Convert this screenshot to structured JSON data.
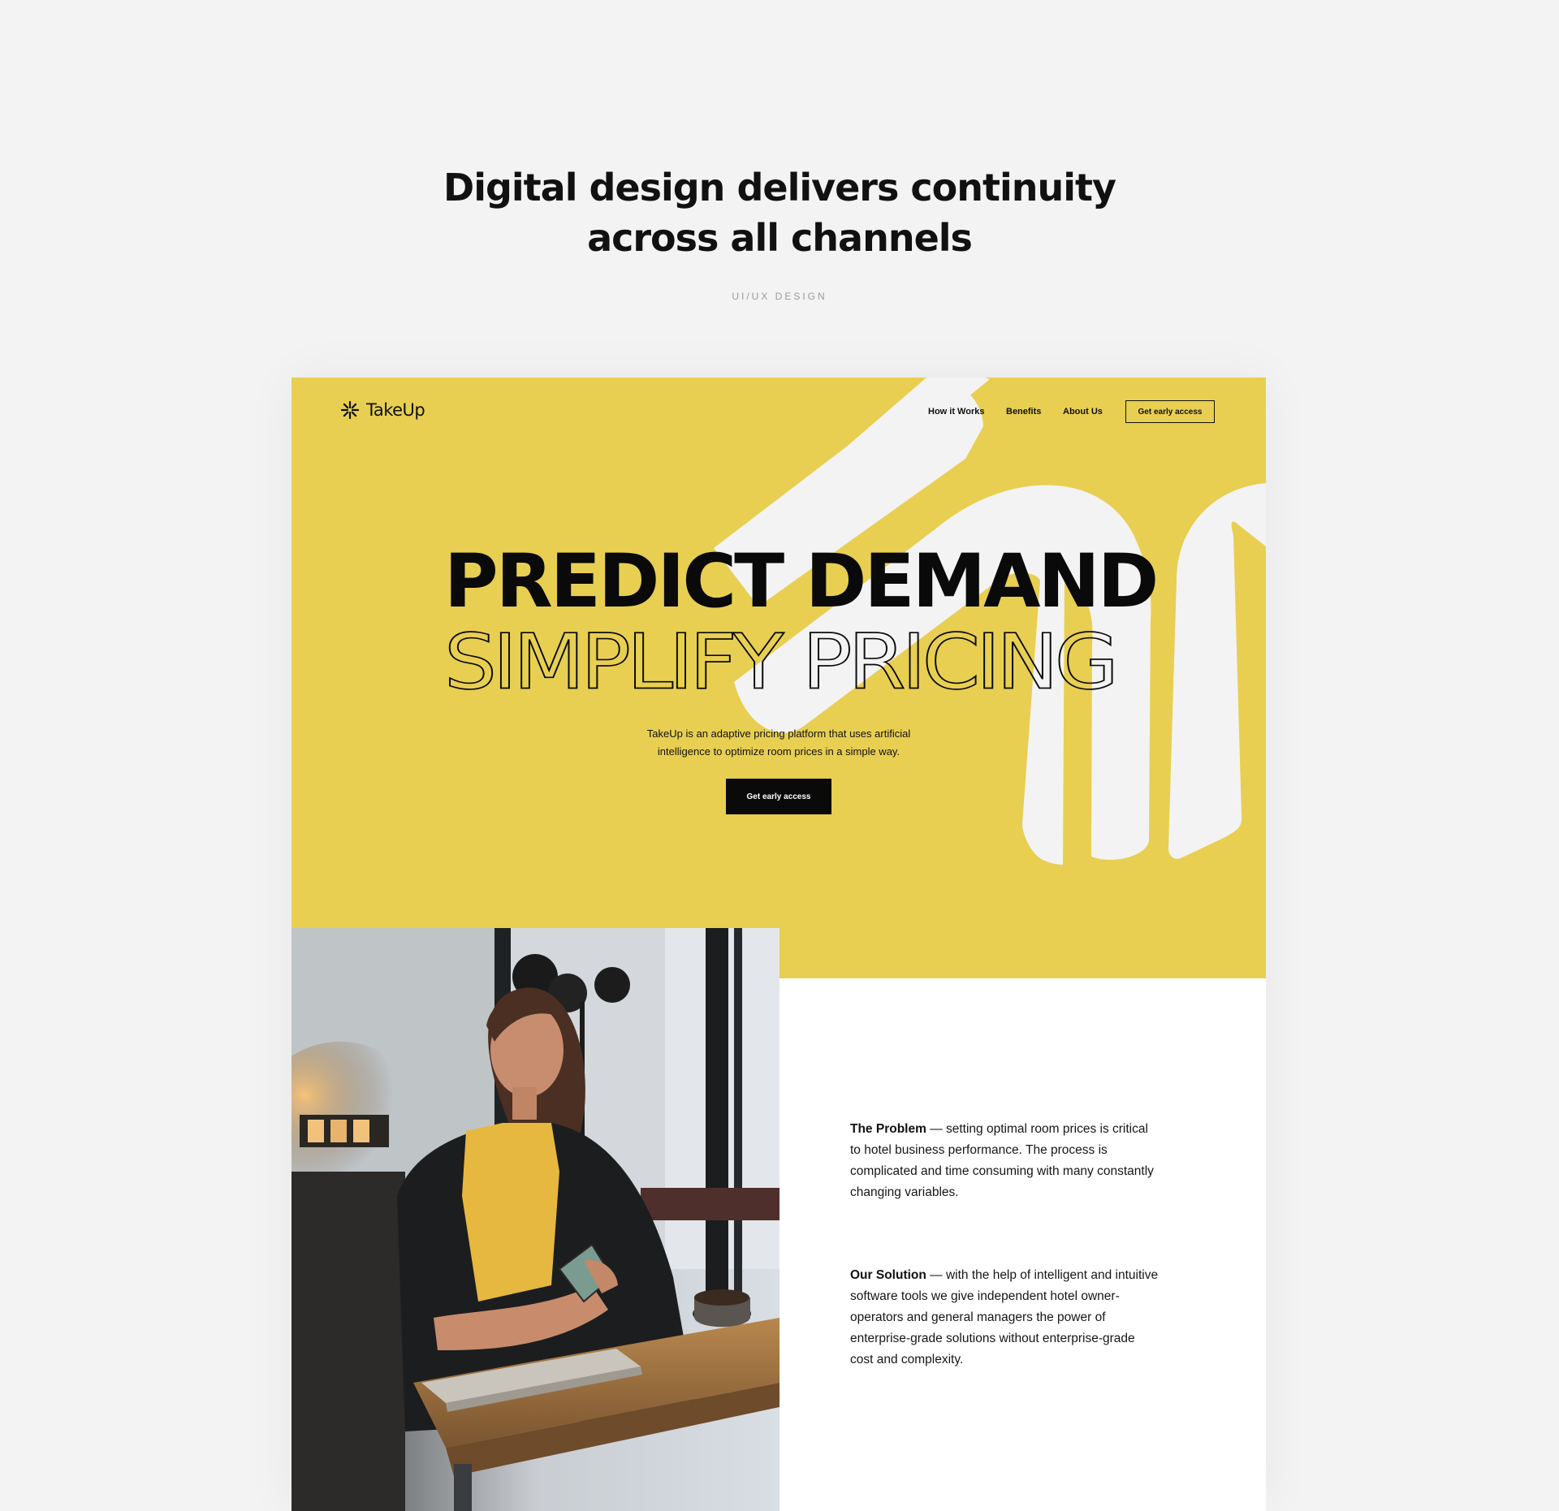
{
  "case": {
    "title_line1": "Digital design delivers continuity",
    "title_line2": "across all channels",
    "tag": "UI/UX DESIGN"
  },
  "site": {
    "brand": "TakeUp",
    "nav": {
      "how_it_works": "How it Works",
      "benefits": "Benefits",
      "about_us": "About Us",
      "cta": "Get early access"
    },
    "hero": {
      "headline_bold": "PREDICT DEMAND",
      "headline_light": "SIMPLIFY PRICING",
      "description_line1": "TakeUp is an adaptive pricing platform that uses artificial",
      "description_line2": "intelligence to optimize room prices in a simple way.",
      "cta": "Get early access"
    },
    "problem": {
      "label": "The Problem",
      "text": " — setting optimal room prices is critical to hotel business performance. The process is complicated and time consuming with many constantly changing variables."
    },
    "solution": {
      "label": "Our Solution",
      "text": " — with the help of intelligent and intuitive software tools we give independent hotel owner-operators and general managers the power of enterprise-grade solutions without enterprise-grade cost and complexity."
    }
  },
  "colors": {
    "hero_yellow": "#e8cf52",
    "page_bg": "#f3f3f3",
    "deco_white": "#f3f3f3",
    "ink": "#0a0a0a"
  },
  "icons": {
    "logo": "asterisk-burst-icon"
  }
}
